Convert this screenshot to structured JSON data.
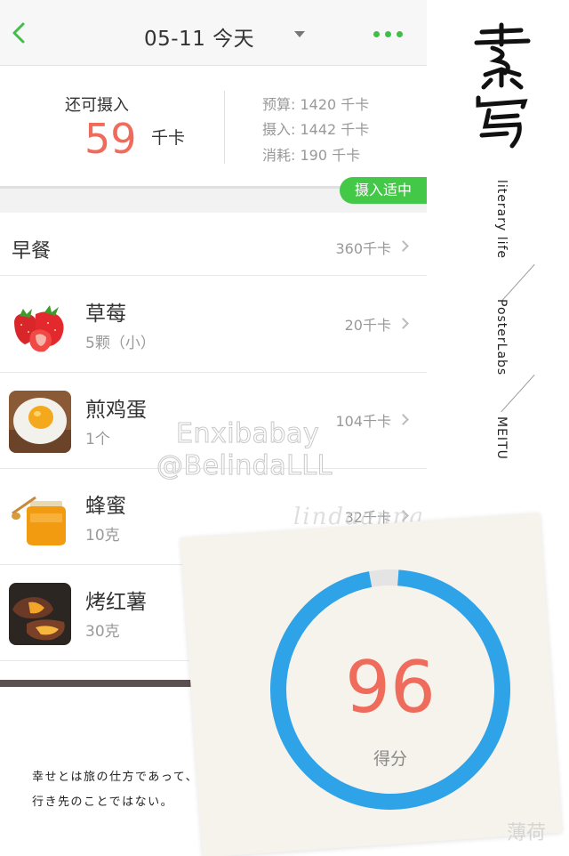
{
  "header": {
    "date_title": "05-11 今天",
    "accent_color": "#3fbf4a"
  },
  "summary": {
    "remain_label": "还可摄入",
    "remain_value": "59",
    "remain_unit": "千卡",
    "budget": "预算: 1420 千卡",
    "intake": "摄入: 1442 千卡",
    "burned": "消耗: 190 千卡",
    "status": "摄入适中",
    "value_color": "#ef6b5c"
  },
  "meal": {
    "name": "早餐",
    "kcal": "360千卡",
    "items": [
      {
        "name": "草莓",
        "amount": "5颗（小）",
        "kcal": "20千卡",
        "icon": "strawberry-icon"
      },
      {
        "name": "煎鸡蛋",
        "amount": "1个",
        "kcal": "104千卡",
        "icon": "fried-egg-icon"
      },
      {
        "name": "蜂蜜",
        "amount": "10克",
        "kcal": "32千卡",
        "icon": "honey-jar-icon"
      },
      {
        "name": "烤红薯",
        "amount": "30克",
        "kcal": "",
        "icon": "sweet-potato-icon"
      }
    ]
  },
  "watermarks": {
    "line1": "Enxibabay",
    "line2": "@BelindaLLL",
    "line3": "lindaanna",
    "corner": "薄荷"
  },
  "poster": {
    "brand": "素写",
    "label1": "literary life",
    "label2": "PosterLabs",
    "label3": "MEITU"
  },
  "score": {
    "value": "96",
    "label": "得分",
    "ring_color": "#2ea3e8",
    "fraction": 0.96
  },
  "quote": {
    "line1": "幸せとは旅の仕方であって、",
    "line2": "行き先のことではない。"
  }
}
